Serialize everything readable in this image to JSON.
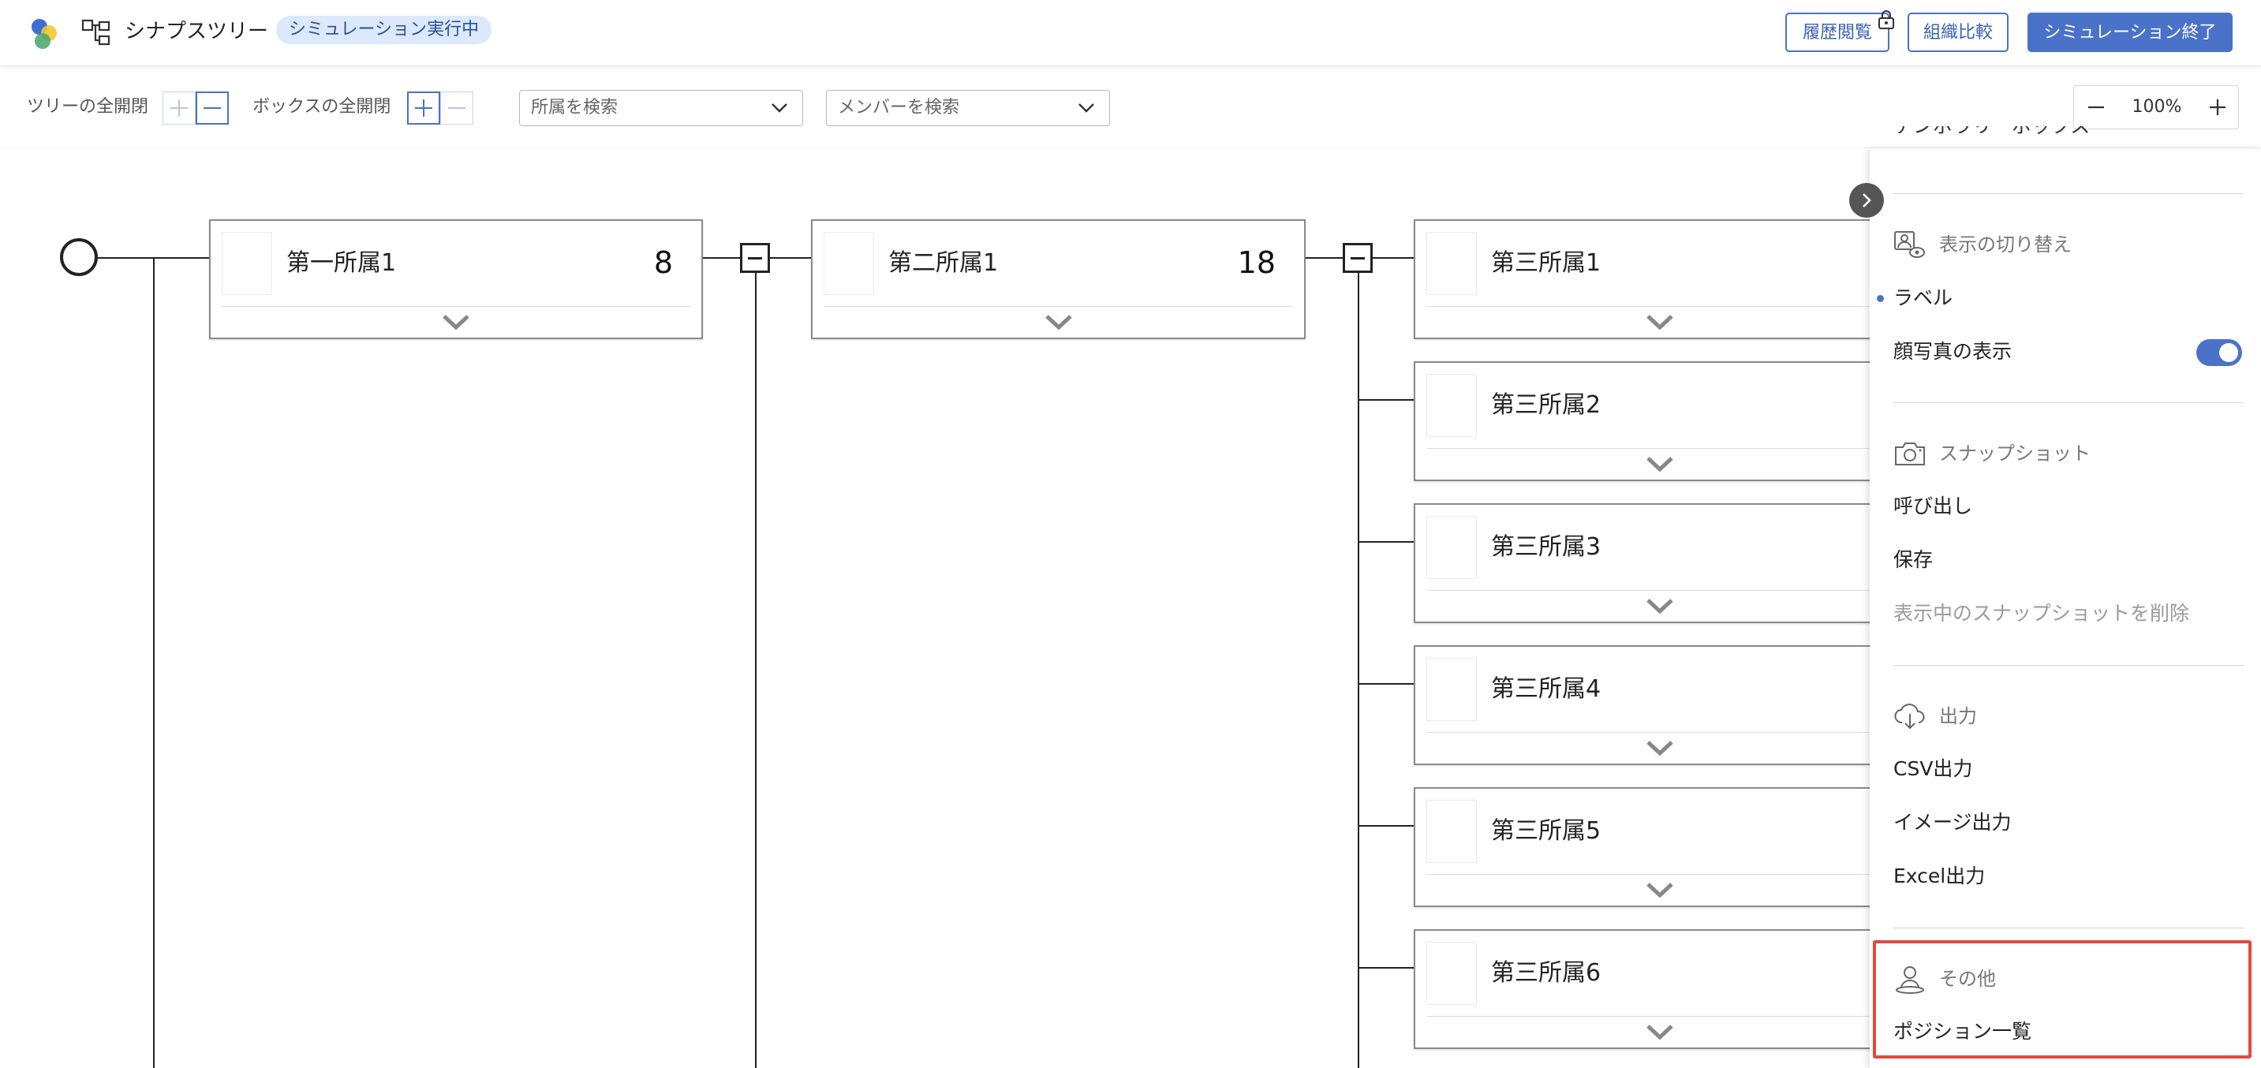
{
  "header": {
    "app_title": "シナプスツリー",
    "status_badge": "シミュレーション実行中",
    "history_button": "履歴閲覧",
    "compare_button": "組織比較",
    "end_button": "シミュレーション終了",
    "colors": {
      "accent": "#4a72c9",
      "badge_bg": "#dce9fb"
    }
  },
  "toolbar": {
    "tree_toggle_label": "ツリーの全開閉",
    "box_toggle_label": "ボックスの全開閉",
    "dept_search_placeholder": "所属を検索",
    "member_search_placeholder": "メンバーを検索",
    "zoom_level": "100%"
  },
  "tree": {
    "level1": [
      {
        "name": "第一所属1",
        "count": "8"
      }
    ],
    "level2": [
      {
        "name": "第二所属1",
        "count": "18"
      }
    ],
    "level3": [
      {
        "name": "第三所属1"
      },
      {
        "name": "第三所属2"
      },
      {
        "name": "第三所属3"
      },
      {
        "name": "第三所属4"
      },
      {
        "name": "第三所属5"
      },
      {
        "name": "第三所属6"
      }
    ]
  },
  "panel": {
    "clipped_top_item": "テンポラリーボックス",
    "display_switch": {
      "title": "表示の切り替え",
      "label_item": "ラベル",
      "face_photo_item": "顔写真の表示",
      "face_photo_on": true
    },
    "snapshot": {
      "title": "スナップショット",
      "recall": "呼び出し",
      "save": "保存",
      "delete_current": "表示中のスナップショットを削除"
    },
    "export": {
      "title": "出力",
      "csv": "CSV出力",
      "image": "イメージ出力",
      "excel": "Excel出力"
    },
    "other": {
      "title": "その他",
      "position_list": "ポジション一覧"
    },
    "colors": {
      "highlight": "#e24a3b"
    }
  }
}
